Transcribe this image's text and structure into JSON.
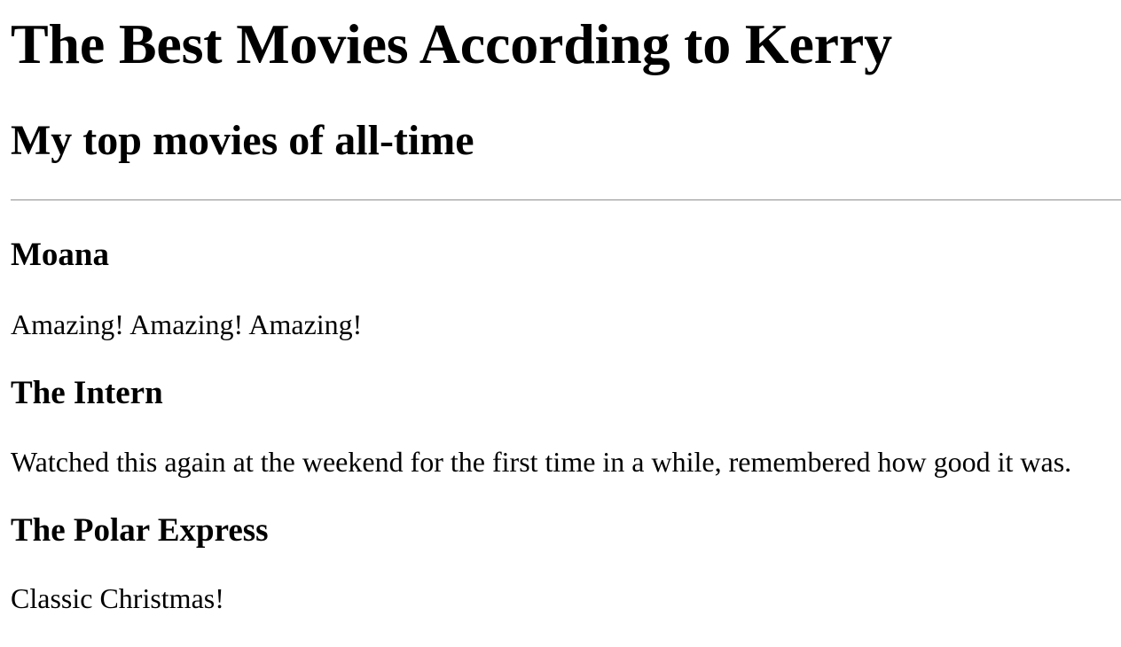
{
  "page": {
    "title": "The Best Movies According to Kerry",
    "subtitle": "My top movies of all-time"
  },
  "movies": [
    {
      "title": "Moana",
      "description": "Amazing! Amazing! Amazing!"
    },
    {
      "title": "The Intern",
      "description": "Watched this again at the weekend for the first time in a while, remembered how good it was."
    },
    {
      "title": "The Polar Express",
      "description": "Classic Christmas!"
    }
  ]
}
